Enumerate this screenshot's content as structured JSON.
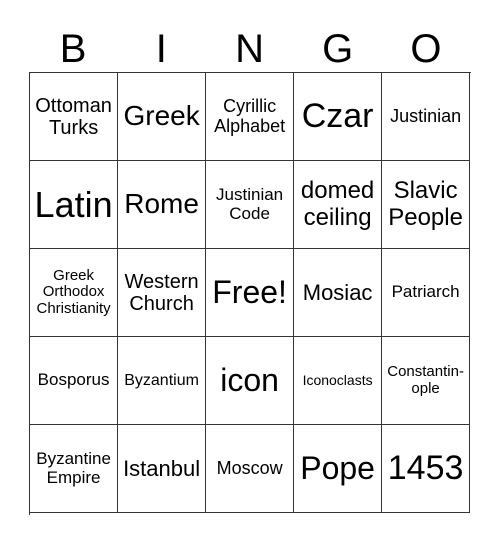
{
  "header": [
    "B",
    "I",
    "N",
    "G",
    "O"
  ],
  "rows": [
    [
      "Ottoman Turks",
      "Greek",
      "Cyrillic Alphabet",
      "Czar",
      "Justinian"
    ],
    [
      "Latin",
      "Rome",
      "Justinian Code",
      "domed ceiling",
      "Slavic People"
    ],
    [
      "Greek Orthodox Christianity",
      "Western Church",
      "Free!",
      "Mosiac",
      "Patriarch"
    ],
    [
      "Bosporus",
      "Byzantium",
      "icon",
      "Iconoclasts",
      "Constantin-ople"
    ],
    [
      "Byzantine Empire",
      "Istanbul",
      "Moscow",
      "Pope",
      "1453"
    ]
  ]
}
